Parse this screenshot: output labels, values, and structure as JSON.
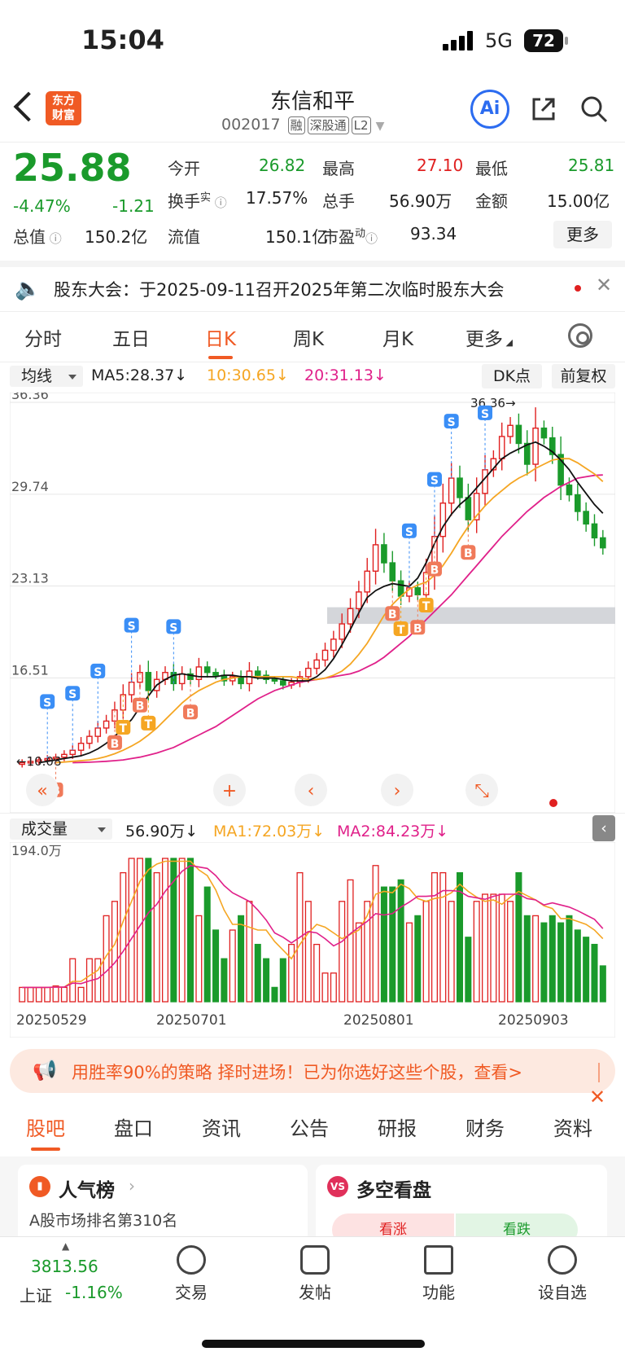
{
  "status": {
    "time": "15:04",
    "network": "5G",
    "battery": "72"
  },
  "header": {
    "title": "东信和平",
    "code": "002017",
    "tags": [
      "融",
      "深股通",
      "L2"
    ],
    "ai_label": "Ai",
    "logo_text": "东方财富"
  },
  "quote": {
    "price": "25.88",
    "pct": "-4.47%",
    "change": "-1.21",
    "open_label": "今开",
    "open": "26.82",
    "high_label": "最高",
    "high": "27.10",
    "low_label": "最低",
    "low": "25.81",
    "turnover_label": "换手",
    "turnover_sup": "实",
    "turnover": "17.57%",
    "volume_label": "总手",
    "volume": "56.90万",
    "amount_label": "金额",
    "amount": "15.00亿",
    "mktcap_label": "总值",
    "mktcap": "150.2亿",
    "float_label": "流值",
    "float": "150.1亿",
    "pe_label": "市盈",
    "pe_sup": "动",
    "pe": "93.34",
    "more_label": "更多"
  },
  "notice": {
    "text": "股东大会：于2025-09-11召开2025年第二次临时股东大会"
  },
  "ktabs": [
    "分时",
    "五日",
    "日K",
    "周K",
    "月K",
    "更多"
  ],
  "kline_legend": {
    "select": "均线",
    "ma5": "MA5:28.37↓",
    "ma10": "10:30.65↓",
    "ma20": "20:31.13↓",
    "dk": "DK点",
    "fq": "前复权"
  },
  "vol_legend": {
    "select": "成交量",
    "vol": "56.90万↓",
    "ma1": "MA1:72.03万↓",
    "ma2": "MA2:84.23万↓"
  },
  "colors": {
    "up": "#e02020",
    "down": "#1a9a2b",
    "ma5": "#111111",
    "ma10": "#f5a623",
    "ma20": "#e0218a",
    "accent": "#f05a24"
  },
  "chart_data": {
    "type": "candlestick",
    "y_ticks": [
      "36.36",
      "29.74",
      "23.13",
      "16.51"
    ],
    "ylim": [
      10.08,
      36.36
    ],
    "high_label": "36.36",
    "low_label": "10.08",
    "x_ticks": [
      "20250529",
      "20250701",
      "20250801",
      "20250903"
    ],
    "vol_max_label": "194.0万",
    "closes": [
      10.4,
      10.5,
      10.6,
      10.7,
      10.8,
      11.0,
      11.3,
      11.8,
      12.3,
      12.9,
      13.4,
      14.2,
      15.3,
      16.2,
      16.9,
      15.6,
      16.4,
      16.9,
      16.1,
      16.8,
      16.4,
      17.3,
      16.9,
      16.7,
      16.3,
      16.6,
      16.1,
      17.0,
      16.7,
      16.4,
      16.3,
      16.0,
      16.2,
      16.6,
      17.2,
      17.8,
      18.5,
      19.3,
      20.4,
      21.5,
      22.7,
      24.2,
      26.1,
      24.8,
      23.5,
      22.4,
      23.0,
      22.5,
      24.1,
      26.7,
      29.1,
      30.9,
      29.5,
      27.9,
      29.8,
      31.5,
      32.3,
      33.9,
      34.7,
      33.4,
      31.9,
      34.5,
      33.8,
      32.6,
      30.4,
      29.7,
      28.5,
      27.6,
      26.6,
      25.88
    ],
    "ma5": [
      10.4,
      10.5,
      10.6,
      10.7,
      10.8,
      10.9,
      11.1,
      11.4,
      11.8,
      12.3,
      12.9,
      13.5,
      14.4,
      15.2,
      16.0,
      16.4,
      16.7,
      16.8,
      16.7,
      16.6,
      16.6,
      16.6,
      16.7,
      16.7,
      16.6,
      16.6,
      16.5,
      16.5,
      16.5,
      16.4,
      16.3,
      16.3,
      16.3,
      16.6,
      17.1,
      17.9,
      18.9,
      20.0,
      21.2,
      22.3,
      22.8,
      23.1,
      23.3,
      23.2,
      23.1,
      23.7,
      24.8,
      26.2,
      27.4,
      28.3,
      29.0,
      29.5,
      30.2,
      30.9,
      31.6,
      32.3,
      32.7,
      33.0,
      33.3,
      33.5,
      33.2,
      32.8,
      32.2,
      31.5,
      30.6,
      29.8,
      29.0,
      28.37
    ],
    "ma10": [
      10.4,
      10.45,
      10.5,
      10.55,
      10.6,
      10.7,
      10.85,
      11.05,
      11.3,
      11.6,
      11.95,
      12.4,
      12.9,
      13.5,
      14.1,
      14.7,
      15.2,
      15.6,
      15.9,
      16.2,
      16.4,
      16.5,
      16.6,
      16.6,
      16.6,
      16.6,
      16.6,
      16.6,
      16.6,
      16.5,
      16.4,
      16.4,
      16.5,
      16.7,
      17.0,
      17.5,
      18.2,
      19.0,
      20.0,
      21.0,
      21.8,
      22.4,
      22.9,
      23.2,
      23.4,
      23.9,
      24.6,
      25.5,
      26.5,
      27.4,
      28.2,
      28.9,
      29.5,
      30.0,
      30.5,
      30.9,
      31.2,
      31.6,
      31.9,
      32.2,
      32.3,
      32.3,
      32.0,
      31.6,
      31.2,
      30.65
    ],
    "ma20": [
      10.4,
      10.42,
      10.44,
      10.47,
      10.5,
      10.55,
      10.6,
      10.7,
      10.8,
      10.95,
      11.1,
      11.3,
      11.5,
      11.8,
      12.1,
      12.4,
      12.7,
      13.0,
      13.4,
      13.8,
      14.2,
      14.6,
      15.0,
      15.3,
      15.6,
      15.8,
      16.0,
      16.2,
      16.3,
      16.4,
      16.5,
      16.6,
      16.7,
      16.8,
      17.0,
      17.3,
      17.6,
      18.0,
      18.5,
      19.0,
      19.5,
      20.1,
      20.7,
      21.3,
      21.9,
      22.5,
      23.2,
      23.9,
      24.6,
      25.3,
      26.0,
      26.7,
      27.3,
      27.9,
      28.5,
      29.0,
      29.5,
      29.9,
      30.3,
      30.6,
      30.9,
      31.0,
      31.1,
      31.13
    ],
    "volumes": [
      10,
      10,
      10,
      10,
      11,
      10,
      30,
      10,
      30,
      30,
      60,
      70,
      90,
      100,
      100,
      100,
      90,
      100,
      100,
      100,
      100,
      60,
      80,
      50,
      30,
      50,
      60,
      70,
      40,
      30,
      10,
      30,
      40,
      90,
      70,
      40,
      20,
      20,
      70,
      85,
      55,
      70,
      95,
      80,
      80,
      85,
      55,
      60,
      70,
      90,
      90,
      70,
      90,
      45,
      70,
      75,
      75,
      75,
      70,
      90,
      60,
      60,
      55,
      60,
      55,
      60,
      50,
      45,
      40,
      25
    ]
  },
  "promo": {
    "text": "用胜率90%的策略 择时进场！已为你选好这些个股，查看>"
  },
  "btabs": [
    "股吧",
    "盘口",
    "资讯",
    "公告",
    "研报",
    "财务",
    "资料"
  ],
  "cards": {
    "left_title": "人气榜",
    "left_sub": "A股市场排名第310名",
    "right_title": "多空看盘",
    "right_up": "看涨",
    "right_down": "看跌"
  },
  "bnav": {
    "index_value": "3813.56",
    "index_name": "上证",
    "index_pct": "-1.16%",
    "trade": "交易",
    "post": "发帖",
    "func": "功能",
    "watch": "设自选"
  }
}
